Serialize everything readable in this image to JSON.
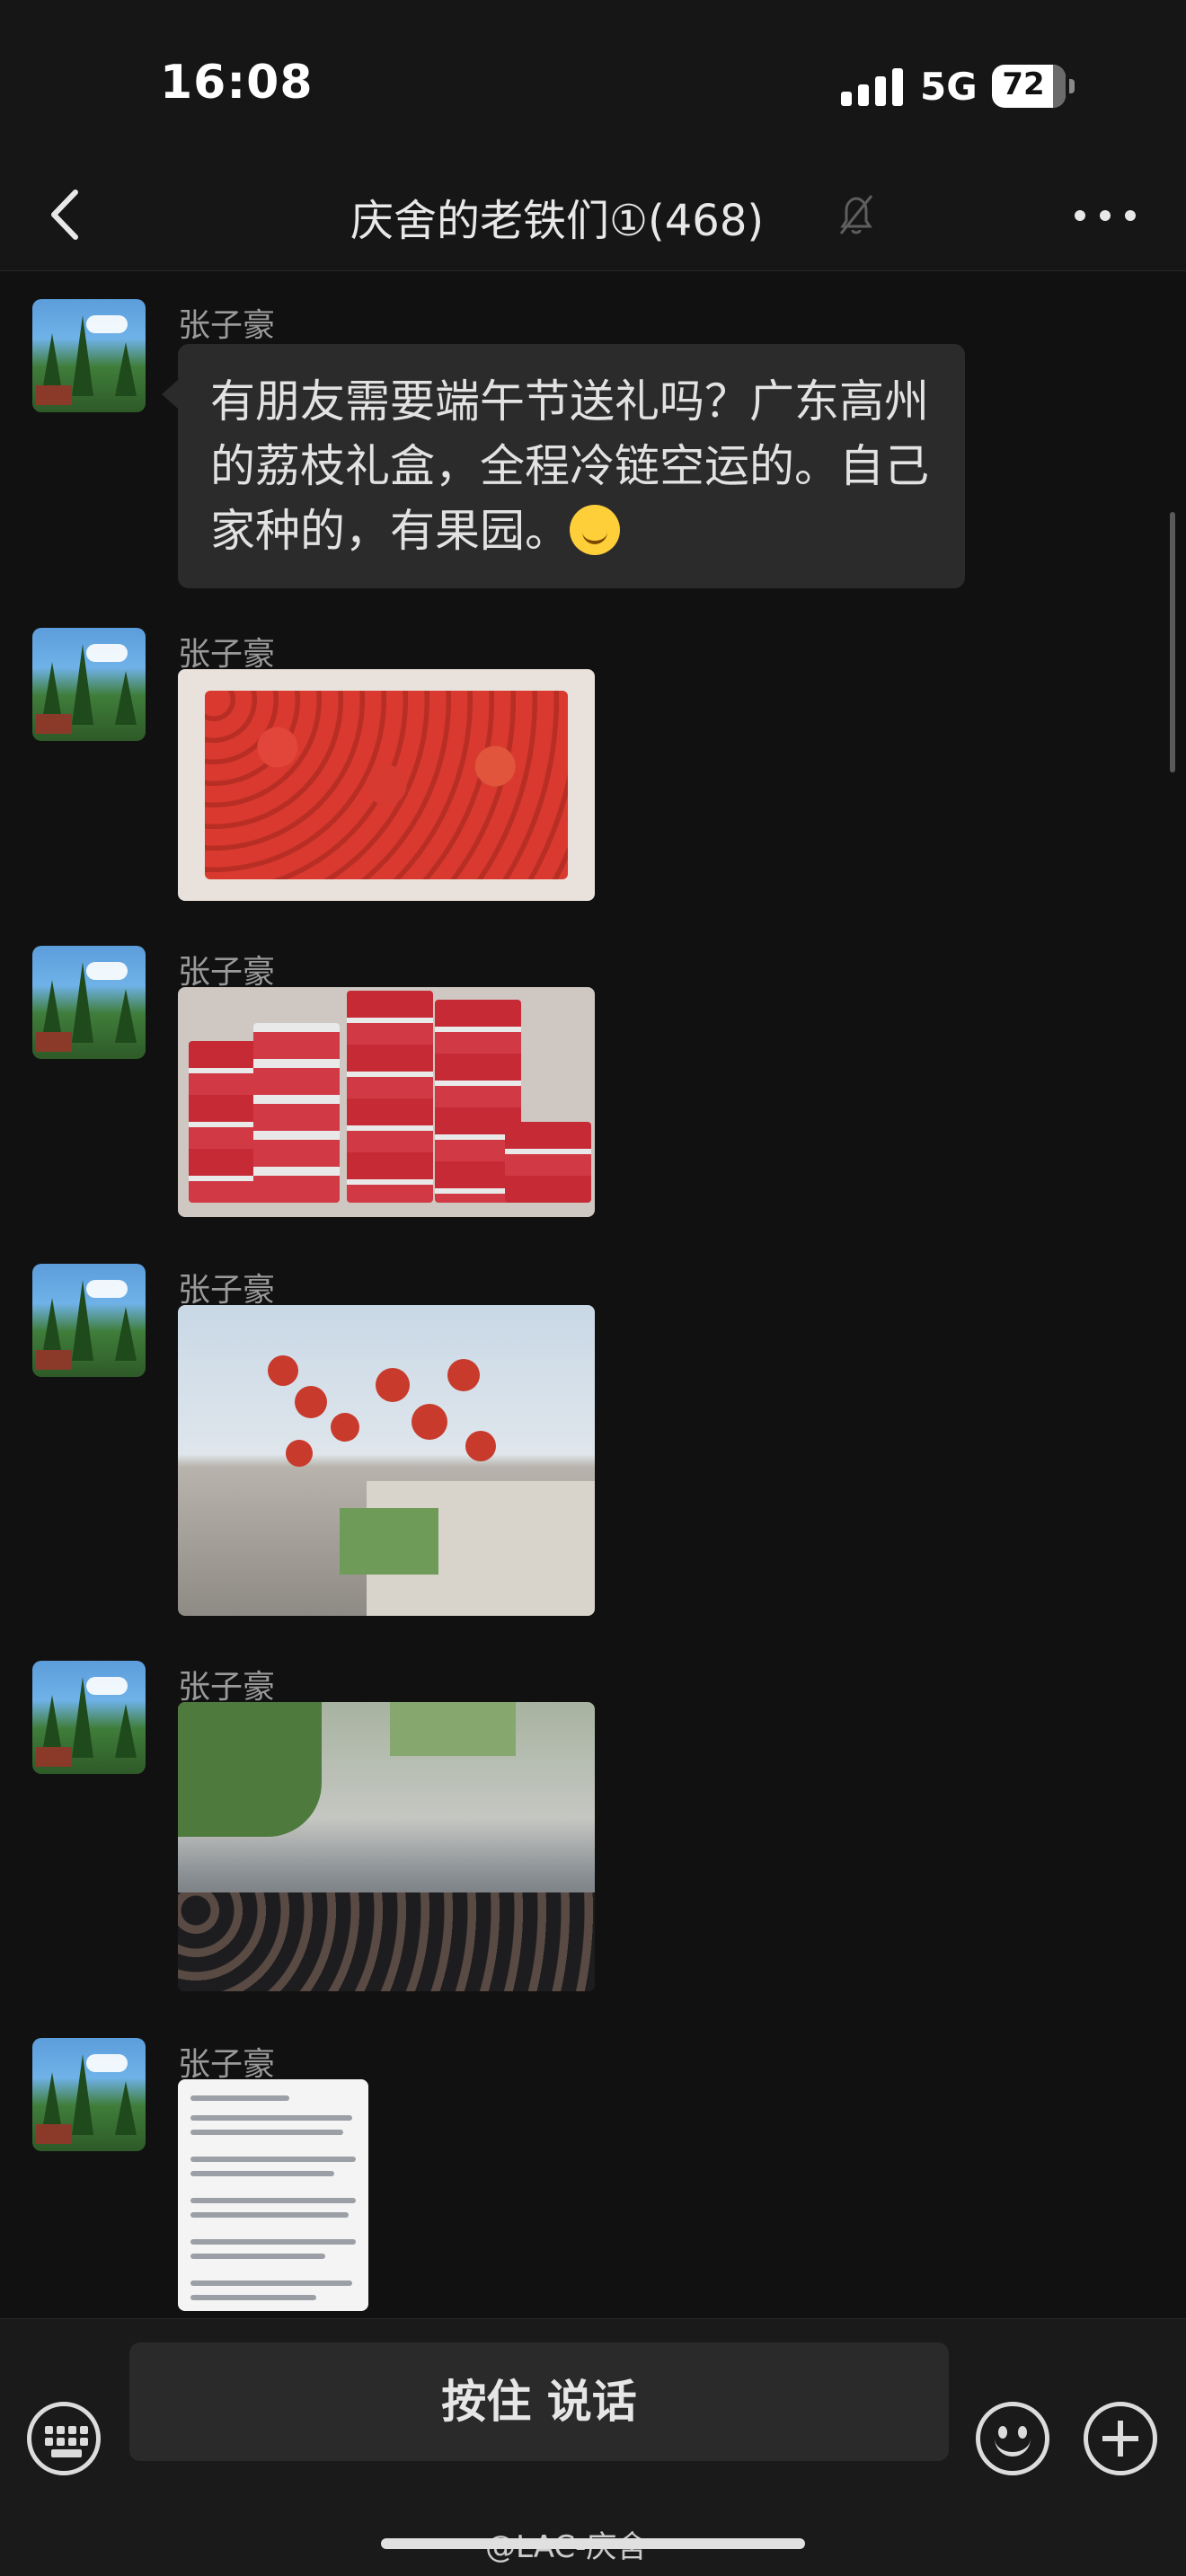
{
  "status_bar": {
    "time": "16:08",
    "network": "5G",
    "battery": "72"
  },
  "nav": {
    "title": "庆舍的老铁们①(468)",
    "back_icon": "chevron-left-icon",
    "mute_icon": "bell-off-icon",
    "more_icon": "more-dots-icon"
  },
  "messages": [
    {
      "sender": "张子豪",
      "type": "text",
      "text": "有朋友需要端午节送礼吗？广东高州的荔枝礼盒，全程冷链空运的。自己家种的，有果园。",
      "emoji": "smiling-face-emoji"
    },
    {
      "sender": "张子豪",
      "type": "image",
      "image": "lychees-in-box-photo"
    },
    {
      "sender": "张子豪",
      "type": "image",
      "image": "stacked-gift-boxes-photo"
    },
    {
      "sender": "张子豪",
      "type": "image",
      "image": "lychee-tree-building-photo"
    },
    {
      "sender": "张子豪",
      "type": "image",
      "image": "crowd-gathering-photo"
    },
    {
      "sender": "张子豪",
      "type": "image",
      "image": "document-screenshot-photo"
    }
  ],
  "input_bar": {
    "voice_label": "按住 说话",
    "keyboard_icon": "keyboard-icon",
    "emoji_icon": "emoji-face-icon",
    "plus_icon": "plus-circle-icon"
  },
  "watermark": "@LAC-庆舍",
  "colors": {
    "background": "#111111",
    "bubble": "#2b2b2b",
    "text": "#e2e2e2",
    "sender": "#9a9a9a"
  }
}
